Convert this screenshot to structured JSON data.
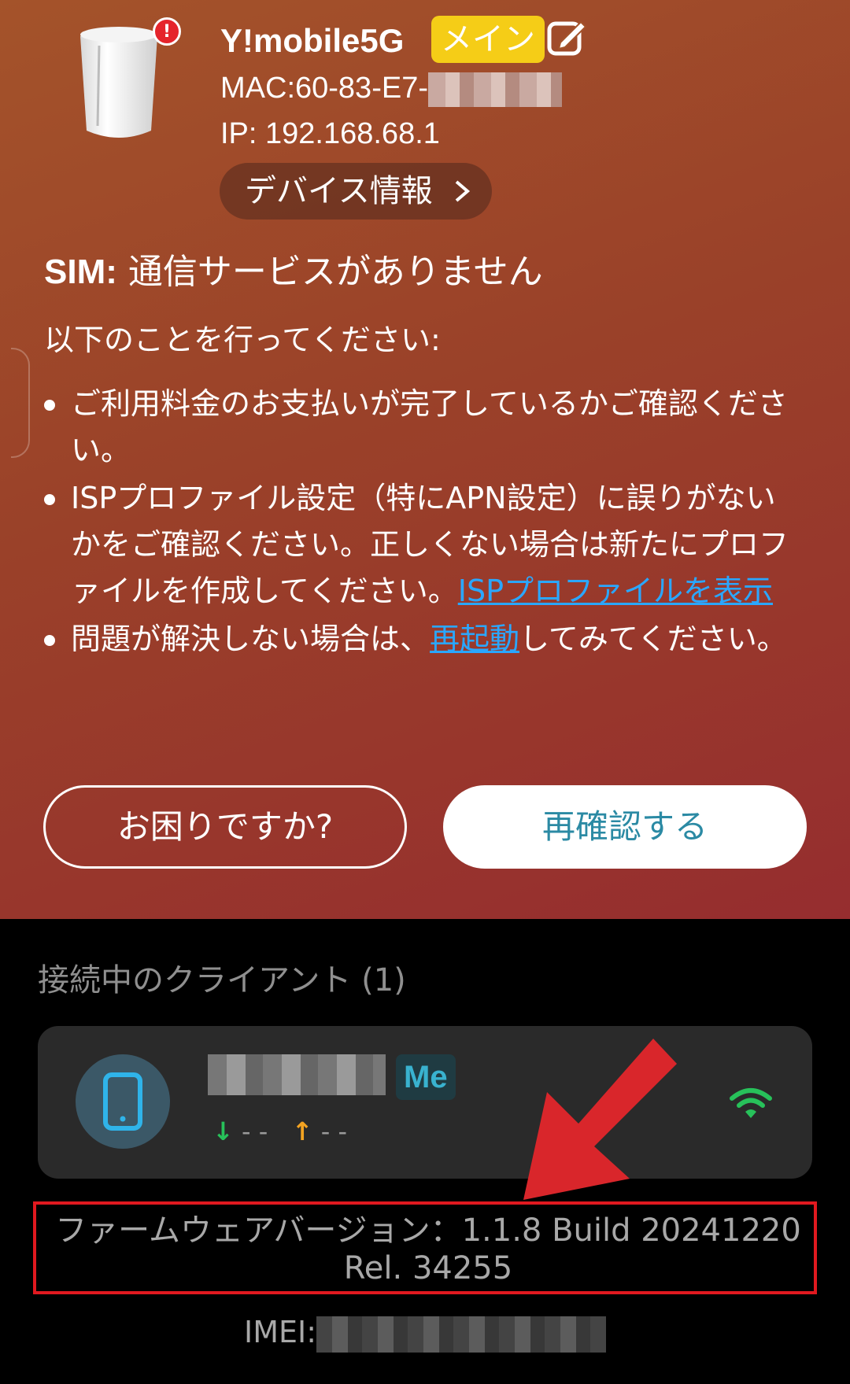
{
  "device": {
    "name": "Y!mobile5G",
    "badge": "メイン",
    "alert": "!",
    "mac_label": "MAC:60-83-E7-",
    "ip_label": "IP: 192.168.68.1",
    "info_button": "デバイス情報"
  },
  "sim": {
    "label": "SIM:",
    "status": "通信サービスがありません"
  },
  "instructions": {
    "heading": "以下のことを行ってください:",
    "bullet1": "ご利用料金のお支払いが完了しているかご確認ください。",
    "bullet2_text": "ISPプロファイル設定（特にAPN設定）に誤りがないかをご確認ください。正しくない場合は新たにプロファイルを作成してください。",
    "bullet2_link": "ISPプロファイルを表示",
    "bullet3_pre": "問題が解決しない場合は、",
    "bullet3_link": "再起動",
    "bullet3_post": "してみてください。"
  },
  "buttons": {
    "help": "お困りですか?",
    "recheck": "再確認する"
  },
  "clients": {
    "title": "接続中のクライアント (1)",
    "me_badge": "Me",
    "down_rate": "- -",
    "up_rate": "- -"
  },
  "firmware": {
    "line1": "ファームウェアバージョン：1.1.8 Build 20241220",
    "line2": "Rel. 34255"
  },
  "imei": {
    "label": "IMEI:"
  },
  "colors": {
    "badge_yellow": "#f5cd17",
    "link_blue": "#2aa7ff",
    "recheck_text": "#2b8aa4",
    "annotation_red": "#e1191f",
    "wifi_green": "#27c15a"
  },
  "icons": {
    "router": "router-icon",
    "edit": "edit-icon",
    "chevron": "chevron-right-icon",
    "phone": "phone-icon",
    "wifi": "wifi-icon",
    "download": "arrow-down-icon",
    "upload": "arrow-up-icon"
  }
}
